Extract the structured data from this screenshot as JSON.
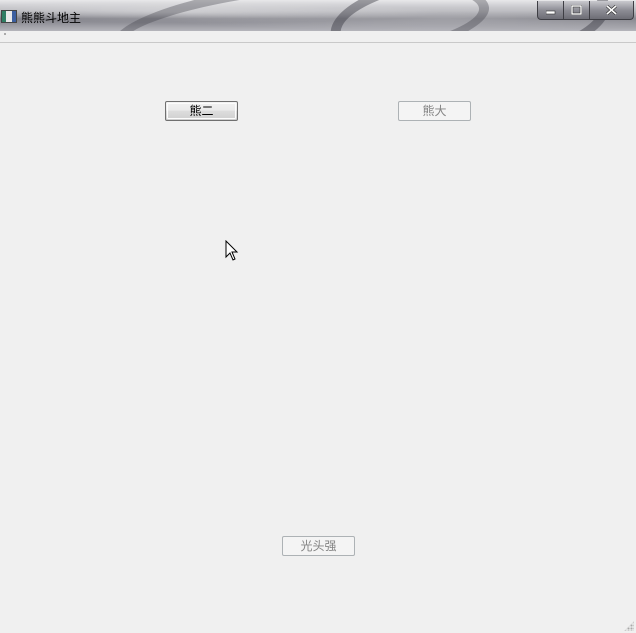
{
  "window": {
    "title": "熊熊斗地主",
    "caption_icons": [
      "minimize-icon",
      "maximize-icon",
      "close-icon"
    ]
  },
  "buttons": {
    "player_two": {
      "label": "熊二",
      "enabled": true
    },
    "player_one": {
      "label": "熊大",
      "enabled": false
    },
    "player_three": {
      "label": "光头强",
      "enabled": false
    }
  },
  "colors": {
    "client_background": "#f0f0f0",
    "disabled_text": "#838383",
    "enabled_text": "#000000"
  }
}
